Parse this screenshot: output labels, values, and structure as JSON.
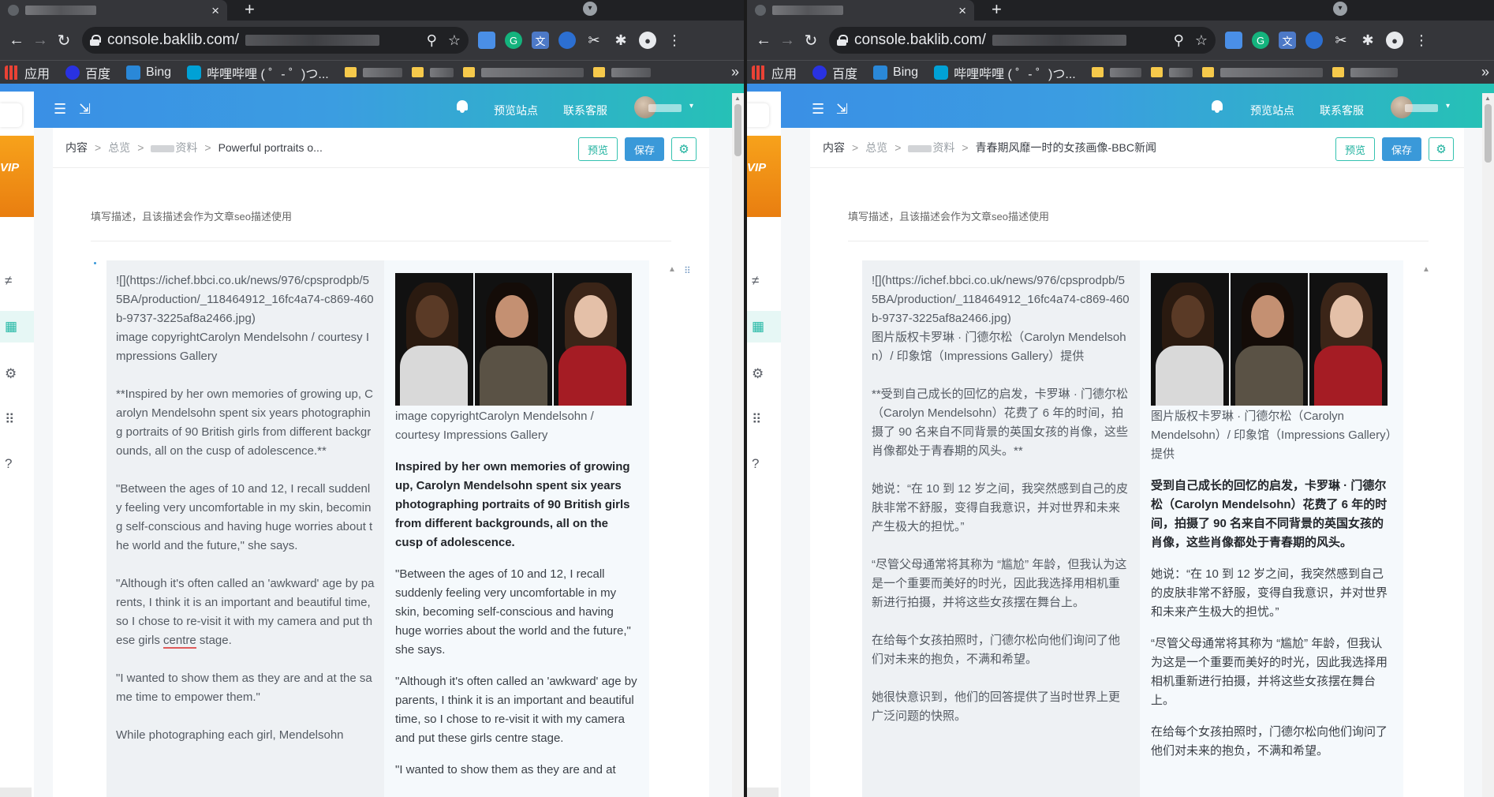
{
  "browser": {
    "url": "console.baklib.com/",
    "tab_close": "×",
    "tab_new": "+",
    "tab_menu": "▾",
    "nav": {
      "back": "←",
      "forward": "→",
      "reload": "↻"
    },
    "zoom_icon": "⚲",
    "star_icon": "☆",
    "bookmarks_more": "»",
    "bookmarks": [
      {
        "label": "应用",
        "icon": "apps-icon"
      },
      {
        "label": "百度",
        "icon": "baidu-icon"
      },
      {
        "label": "Bing",
        "icon": "bing-icon"
      },
      {
        "label": "哔哩哔哩 ( ゜- ゜)つ...",
        "icon": "bilibili-icon"
      }
    ],
    "extension_labels": {
      "grammarly": "G",
      "translate": "文",
      "cut": "✂",
      "puzzle": "✱",
      "menu": "⋮",
      "profile": "●"
    }
  },
  "app": {
    "header": {
      "menu_icon": "☰",
      "collapse_icon": "⇲",
      "preview_site": "预览站点",
      "contact_support": "联系客服",
      "caret": "▾"
    },
    "sidebar": {
      "vip_label": "VIP",
      "icons": [
        "≠",
        "▦",
        "⚙",
        "⠿",
        "?"
      ]
    },
    "seo_placeholder": "填写描述，且该描述会作为文章seo描述使用",
    "buttons": {
      "preview": "预览",
      "save": "保存",
      "settings": "⚙"
    },
    "editor_ui": {
      "scroll_up": "▲",
      "drag_handle": "⠿"
    }
  },
  "left": {
    "breadcrumb": {
      "root": "内容",
      "overview": "总览",
      "folder": "资料",
      "current": "Powerful portraits o..."
    },
    "source": {
      "image_md": "![](https://ichef.bbci.co.uk/news/976/cpsprodpb/55BA/production/_118464912_16fc4a74-c869-460b-9737-3225af8a2466.jpg)",
      "image_copyright": "image copyrightCarolyn Mendelsohn / courtesy Impressions Gallery",
      "p1": "**Inspired by her own memories of growing up, Carolyn Mendelsohn spent six years photographing portraits of 90 British girls from different backgrounds, all on the cusp of adolescence.**",
      "p2": "\"Between the ages of 10 and 12, I recall suddenly feeling very uncomfortable in my skin, becoming self-conscious and having huge worries about the world and the future,\" she says.",
      "p3a": "\"Although it's often called an 'awkward' age by parents, I think it is an important and beautiful time, so I chose to re-visit it with my camera and put these girls ",
      "p3b": "centre",
      "p3c": " stage.",
      "p4": "\"I wanted to show them as they are and at the same time to empower them.\"",
      "p5": "While photographing each girl, Mendelsohn"
    },
    "preview": {
      "caption": "image copyrightCarolyn Mendelsohn / courtesy Impressions Gallery",
      "p1": "Inspired by her own memories of growing up, Carolyn Mendelsohn spent six years photographing portraits of 90 British girls from different backgrounds, all on the cusp of adolescence.",
      "p2": "\"Between the ages of 10 and 12, I recall suddenly feeling very uncomfortable in my skin, becoming self-conscious and having huge worries about the world and the future,\" she says.",
      "p3": "\"Although it's often called an 'awkward' age by parents, I think it is an important and beautiful time, so I chose to re-visit it with my camera and put these girls centre stage.",
      "p4": "\"I wanted to show them as they are and at"
    }
  },
  "right": {
    "breadcrumb": {
      "root": "内容",
      "overview": "总览",
      "folder": "资料",
      "current": "青春期风靡一时的女孩画像-BBC新闻"
    },
    "source": {
      "image_md": "![](https://ichef.bbci.co.uk/news/976/cpsprodpb/55BA/production/_118464912_16fc4a74-c869-460b-9737-3225af8a2466.jpg)",
      "image_copyright": "图片版权卡罗琳 · 门德尔松（Carolyn Mendelsohn）/ 印象馆（Impressions Gallery）提供",
      "p1": "**受到自己成长的回忆的启发，卡罗琳 · 门德尔松（Carolyn Mendelsohn）花费了 6 年的时间，拍摄了 90 名来自不同背景的英国女孩的肖像，这些肖像都处于青春期的风头。**",
      "p2": "她说：“在 10 到 12 岁之间，我突然感到自己的皮肤非常不舒服，变得自我意识，并对世界和未来产生极大的担忧。”",
      "p3": "“尽管父母通常将其称为 “尴尬” 年龄，但我认为这是一个重要而美好的时光，因此我选择用相机重新进行拍摄，并将这些女孩摆在舞台上。",
      "p4": "在给每个女孩拍照时，门德尔松向他们询问了他们对未来的抱负，不满和希望。",
      "p5": "她很快意识到，他们的回答提供了当时世界上更广泛问题的快照。"
    },
    "preview": {
      "caption": "图片版权卡罗琳 · 门德尔松（Carolyn Mendelsohn）/ 印象馆（Impressions Gallery）提供",
      "p1": "受到自己成长的回忆的启发，卡罗琳 · 门德尔松（Carolyn Mendelsohn）花费了 6 年的时间，拍摄了 90 名来自不同背景的英国女孩的肖像，这些肖像都处于青春期的风头。",
      "p2": "她说：“在 10 到 12 岁之间，我突然感到自己的皮肤非常不舒服，变得自我意识，并对世界和未来产生极大的担忧。”",
      "p3": "“尽管父母通常将其称为 “尴尬” 年龄，但我认为这是一个重要而美好的时光，因此我选择用相机重新进行拍摄，并将这些女孩摆在舞台上。",
      "p4": "在给每个女孩拍照时，门德尔松向他们询问了他们对未来的抱负，不满和希望。"
    }
  },
  "colors": {
    "accent": "#24b8a5",
    "primary": "#3a99d9",
    "vip": "#f7a21b"
  }
}
